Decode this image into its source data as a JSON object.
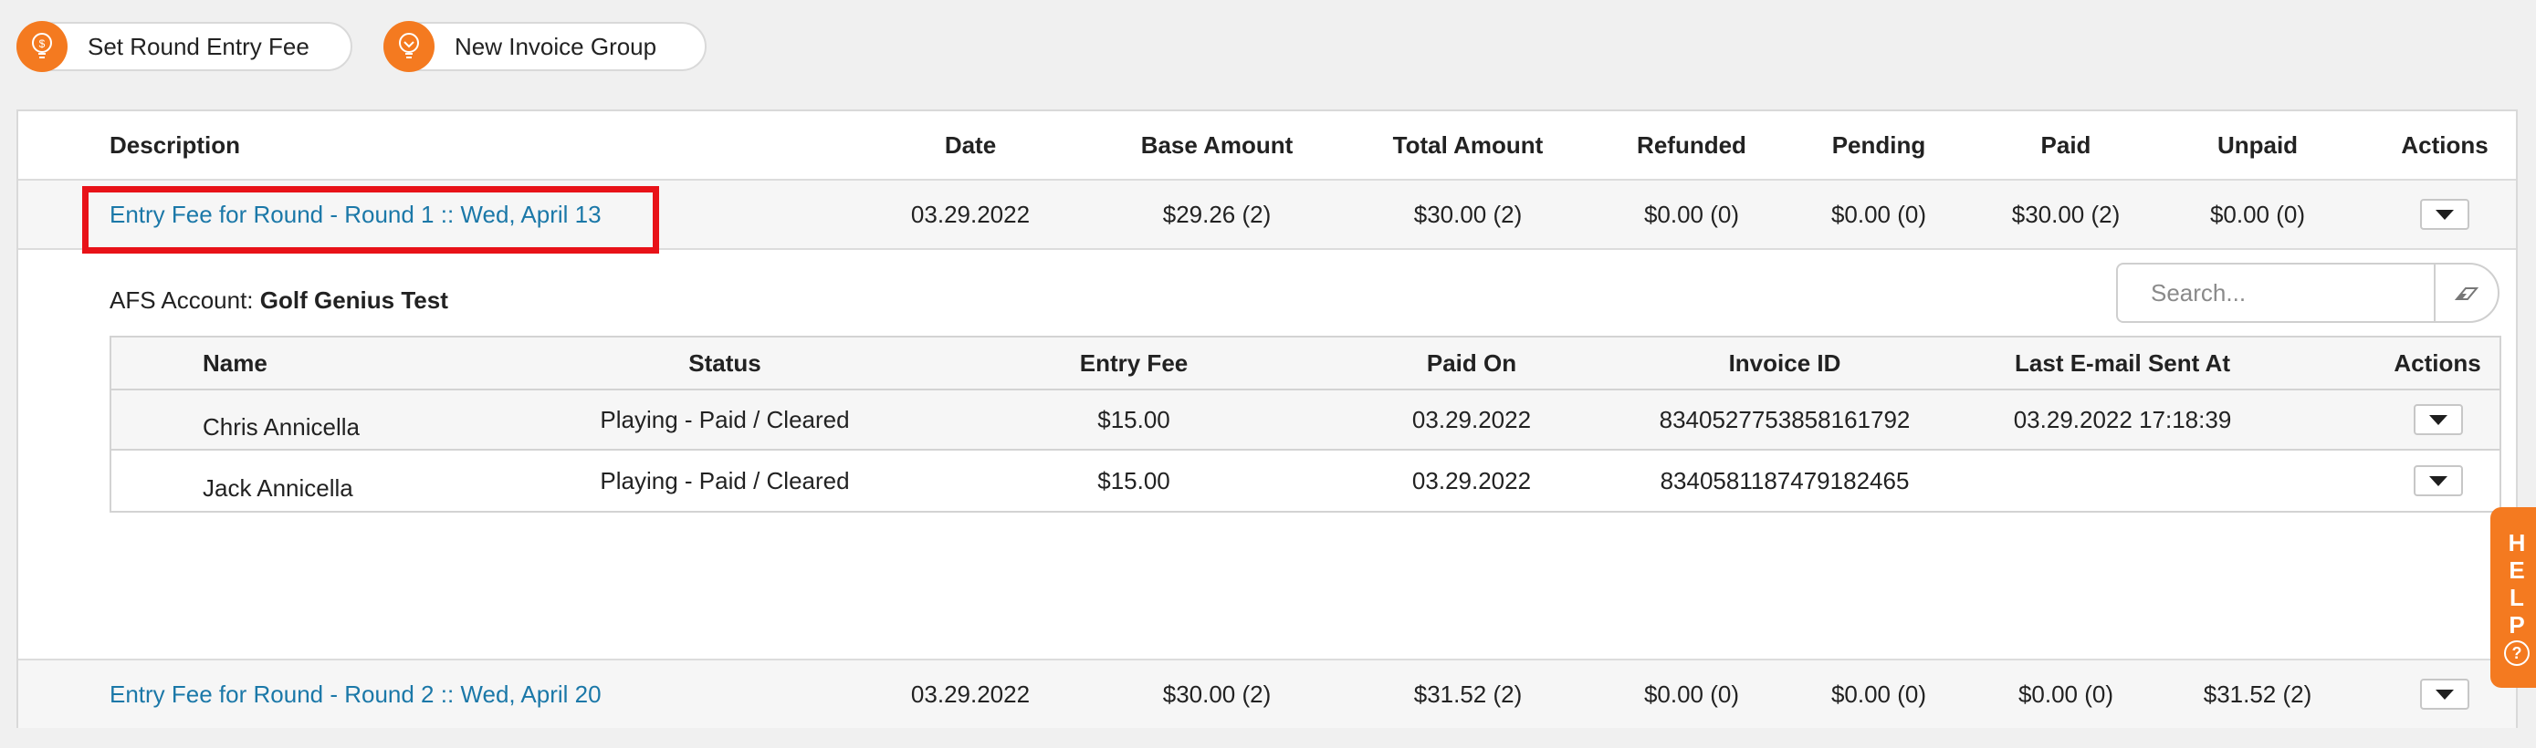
{
  "toolbar": {
    "set_round_entry_fee": "Set Round Entry Fee",
    "new_invoice_group": "New Invoice Group"
  },
  "table": {
    "headers": [
      "Description",
      "Date",
      "Base Amount",
      "Total Amount",
      "Refunded",
      "Pending",
      "Paid",
      "Unpaid",
      "Actions"
    ],
    "rows": [
      {
        "description": "Entry Fee for Round - Round 1 :: Wed, April 13",
        "date": "03.29.2022",
        "base_amount": "$29.26 (2)",
        "total_amount": "$30.00 (2)",
        "refunded": "$0.00 (0)",
        "pending": "$0.00 (0)",
        "paid": "$30.00 (2)",
        "unpaid": "$0.00 (0)"
      },
      {
        "description": "Entry Fee for Round - Round 2 :: Wed, April 20",
        "date": "03.29.2022",
        "base_amount": "$30.00 (2)",
        "total_amount": "$31.52 (2)",
        "refunded": "$0.00 (0)",
        "pending": "$0.00 (0)",
        "paid": "$0.00 (0)",
        "unpaid": "$31.52 (2)"
      }
    ]
  },
  "expanded": {
    "afs_label": "AFS Account:",
    "afs_value": "Golf Genius Test",
    "search_placeholder": "Search...",
    "headers": [
      "Name",
      "Status",
      "Entry Fee",
      "Paid On",
      "Invoice ID",
      "Last E-mail Sent At",
      "Actions"
    ],
    "rows": [
      {
        "name": "Chris Annicella",
        "status": "Playing - Paid / Cleared",
        "entry_fee": "$15.00",
        "paid_on": "03.29.2022",
        "invoice_id": "8340527753858161792",
        "last_email": "03.29.2022 17:18:39"
      },
      {
        "name": "Jack Annicella",
        "status": "Playing - Paid / Cleared",
        "entry_fee": "$15.00",
        "paid_on": "03.29.2022",
        "invoice_id": "8340581187479182465",
        "last_email": ""
      }
    ]
  },
  "help": {
    "letters": [
      "H",
      "E",
      "L",
      "P"
    ],
    "question": "?"
  },
  "colors": {
    "accent": "#f47a20",
    "link": "#1b78a8",
    "highlight": "#e81218"
  },
  "icons": {
    "toolbar": "lightbulb-icon",
    "row_actions": "caret-down-icon",
    "search_clear": "eraser-icon"
  }
}
